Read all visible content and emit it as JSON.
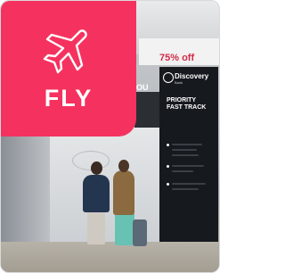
{
  "tile": {
    "label": "FLY",
    "icon": "airplane-icon",
    "accent_color": "#f5325f"
  },
  "photo": {
    "promo_text": "75% off",
    "sign_stand_text": "OU",
    "fast_track_sign": {
      "brand": "Discovery",
      "sub": "Bank",
      "heading_line1": "PRIORITY",
      "heading_line2": "FAST TRACK"
    }
  }
}
